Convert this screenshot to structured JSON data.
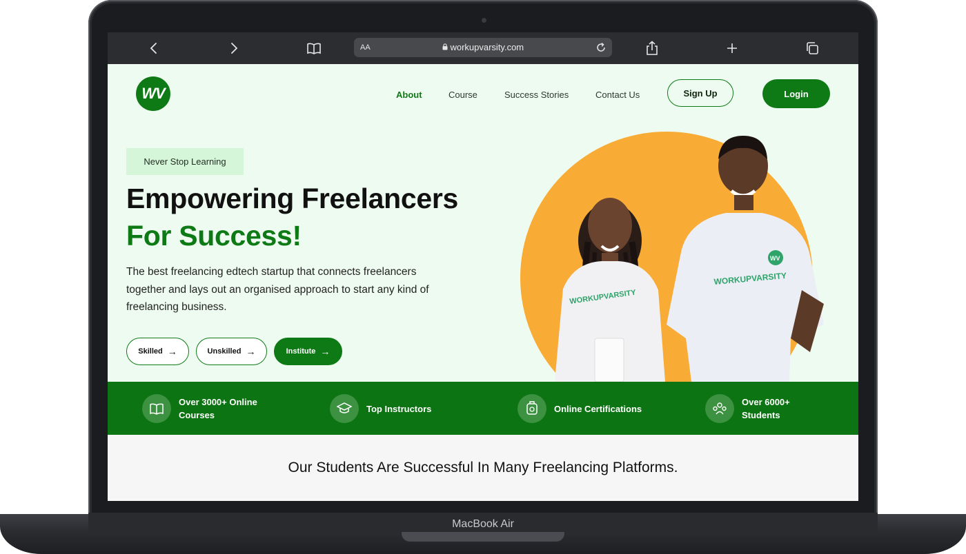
{
  "device": {
    "model_label": "MacBook Air"
  },
  "browser": {
    "text_size_label": "AA",
    "url": "workupvarsity.com",
    "icons": [
      "back-icon",
      "forward-icon",
      "bookmarks-icon",
      "lock-icon",
      "reload-icon",
      "share-icon",
      "new-tab-icon",
      "tabs-icon"
    ]
  },
  "site": {
    "logo_text": "WV",
    "nav": [
      {
        "label": "About",
        "active": true
      },
      {
        "label": "Course"
      },
      {
        "label": "Success Stories"
      },
      {
        "label": "Contact Us"
      }
    ],
    "signup_label": "Sign Up",
    "login_label": "Login"
  },
  "hero": {
    "tagline": "Never Stop Learning",
    "title_line1": "Empowering Freelancers",
    "title_line2": "For Success!",
    "description": "The best freelancing edtech startup that connects freelancers together and lays out an organised approach to start any kind of freelancing business.",
    "buttons": [
      {
        "label": "Skilled"
      },
      {
        "label": "Unskilled"
      },
      {
        "label": "Institute"
      }
    ],
    "shirt_text": "WORKUPVARSITY",
    "shirt_logo": "WV"
  },
  "stats": [
    {
      "label_line1": "Over 3000+ Online",
      "label_line2": "Courses",
      "icon": "book-icon"
    },
    {
      "label_line1": "Top Instructors",
      "label_line2": "",
      "icon": "graduation-cap-icon"
    },
    {
      "label_line1": "Online Certifications",
      "label_line2": "",
      "icon": "certificate-icon"
    },
    {
      "label_line1": "Over 6000+",
      "label_line2": "Students",
      "icon": "students-icon"
    }
  ],
  "platforms": {
    "title": "Our Students Are Successful In Many Freelancing Platforms."
  },
  "colors": {
    "brand_green": "#0e7a16",
    "accent_orange": "#f8ab35",
    "hero_bg": "#eefbf0"
  }
}
